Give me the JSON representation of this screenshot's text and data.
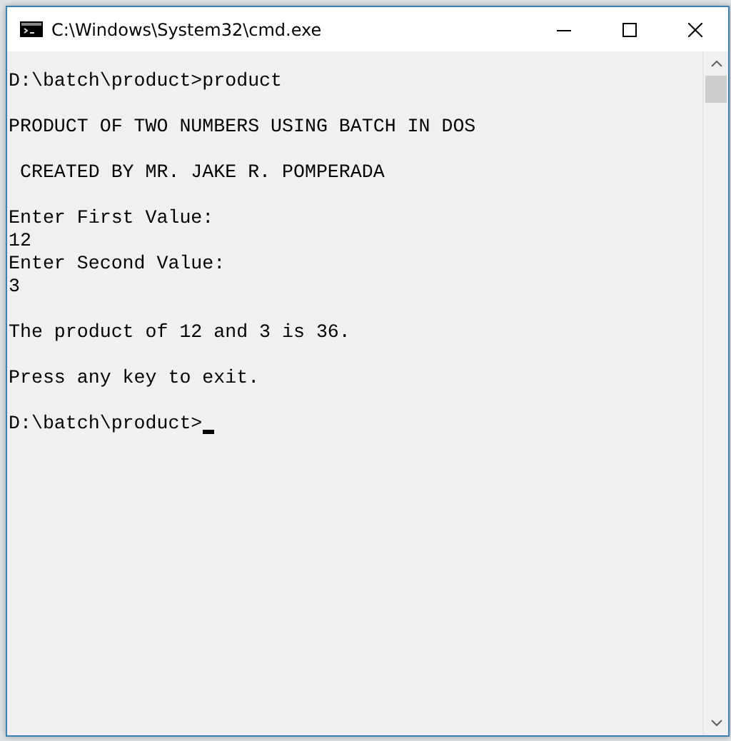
{
  "window": {
    "title": "C:\\Windows\\System32\\cmd.exe"
  },
  "console": {
    "cursor": true,
    "blocks": [
      {
        "lines": [
          "D:\\batch\\product>product"
        ]
      },
      {
        "lines": [
          "PRODUCT OF TWO NUMBERS USING BATCH IN DOS"
        ]
      },
      {
        "lines": [
          " CREATED BY MR. JAKE R. POMPERADA"
        ]
      },
      {
        "lines": [
          "Enter First Value:",
          "12",
          "Enter Second Value:",
          "3"
        ]
      },
      {
        "lines": [
          "The product of 12 and 3 is 36."
        ]
      },
      {
        "lines": [
          "Press any key to exit."
        ]
      },
      {
        "lines": [
          "D:\\batch\\product>"
        ]
      }
    ]
  }
}
